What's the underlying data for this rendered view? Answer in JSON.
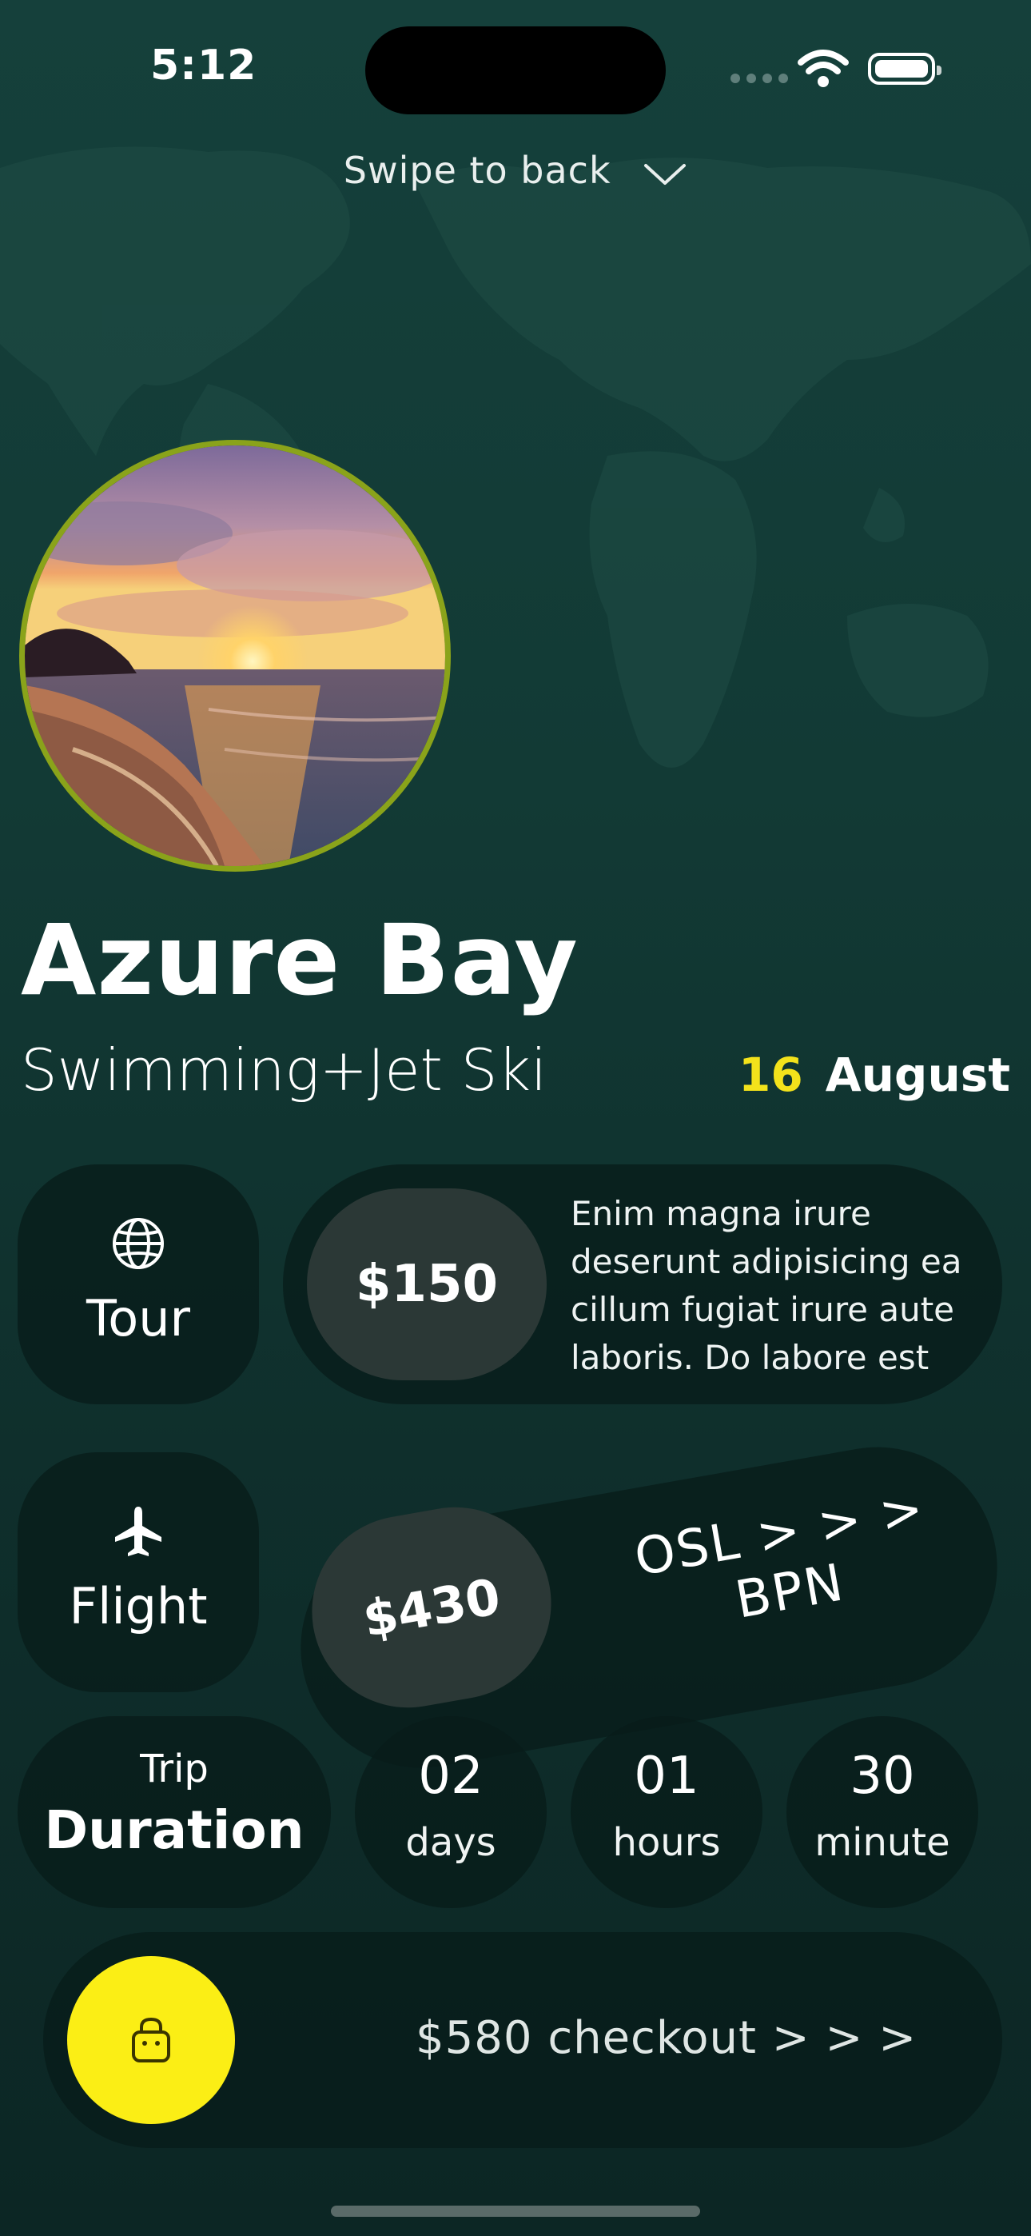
{
  "status_bar": {
    "time": "5:12"
  },
  "header": {
    "swipe_label": "Swipe to back"
  },
  "destination": {
    "title": "Azure Bay",
    "activity": "Swimming+Jet Ski",
    "date_day": "16",
    "date_month": "August"
  },
  "tour": {
    "label": "Tour",
    "price": "$150",
    "description": "Enim magna irure deserunt adipisicing ea cillum fugiat irure aute laboris. Do labore est"
  },
  "flight": {
    "label": "Flight",
    "price": "$430",
    "route": "OSL > > > BPN"
  },
  "trip_duration": {
    "label_small": "Trip",
    "label_big": "Duration",
    "items": [
      {
        "value": "02",
        "unit": "days"
      },
      {
        "value": "01",
        "unit": "hours"
      },
      {
        "value": "30",
        "unit": "minute"
      }
    ]
  },
  "checkout": {
    "label": "$580  checkout > > >"
  },
  "colors": {
    "accent_yellow": "#fbee15",
    "photo_border": "#8aa31a",
    "background": "#123a35"
  },
  "icons": {
    "globe": "globe-icon",
    "plane": "plane-icon",
    "bag": "shopping-bag-icon",
    "chevron": "chevron-down-icon"
  }
}
